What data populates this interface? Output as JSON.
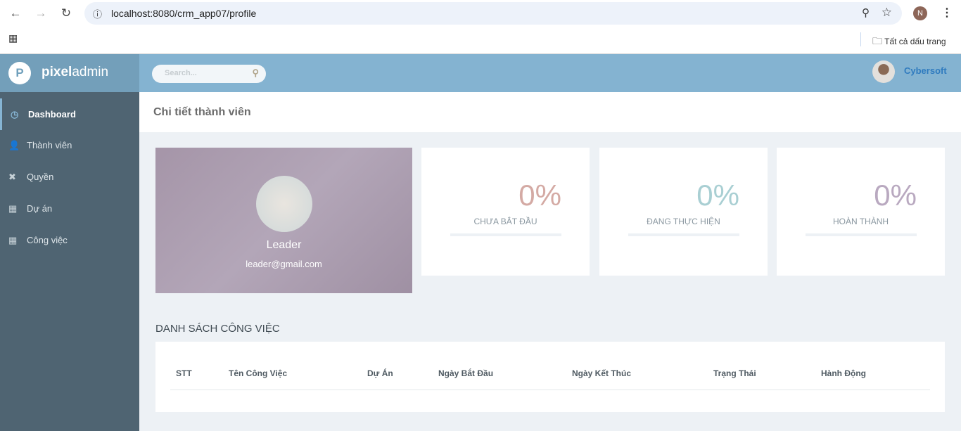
{
  "browser": {
    "url": "localhost:8080/crm_app07/profile",
    "bookmarks_label": "Tất cả dấu trang",
    "profile_initial": "N"
  },
  "app": {
    "logo_letter": "P",
    "logo_bold": "pixel",
    "logo_light": "admin",
    "search_placeholder": "Search...",
    "user_name": "Cybersoft"
  },
  "sidebar": {
    "items": [
      {
        "label": "Dashboard",
        "icon": "clock-icon"
      },
      {
        "label": "Thành viên",
        "icon": "user-icon"
      },
      {
        "label": "Quyền",
        "icon": "puzzle-icon"
      },
      {
        "label": "Dự án",
        "icon": "table-icon"
      },
      {
        "label": "Công việc",
        "icon": "table-icon"
      }
    ]
  },
  "page": {
    "title": "Chi tiết thành viên"
  },
  "profile": {
    "name": "Leader",
    "email": "leader@gmail.com"
  },
  "stats": [
    {
      "value": "0%",
      "label": "CHƯA BẮT ĐẦU",
      "progress": 0,
      "color": "#d4aaa4"
    },
    {
      "value": "0%",
      "label": "ĐANG THỰC HIỆN",
      "progress": 0,
      "color": "#a9cfd3"
    },
    {
      "value": "0%",
      "label": "HOÀN THÀNH",
      "progress": 0,
      "color": "#b9a9c0"
    }
  ],
  "tasks": {
    "title": "DANH SÁCH CÔNG VIỆC",
    "columns": [
      "STT",
      "Tên Công Việc",
      "Dự Án",
      "Ngày Bắt Đầu",
      "Ngày Kết Thúc",
      "Trạng Thái",
      "Hành Động"
    ],
    "rows": []
  }
}
